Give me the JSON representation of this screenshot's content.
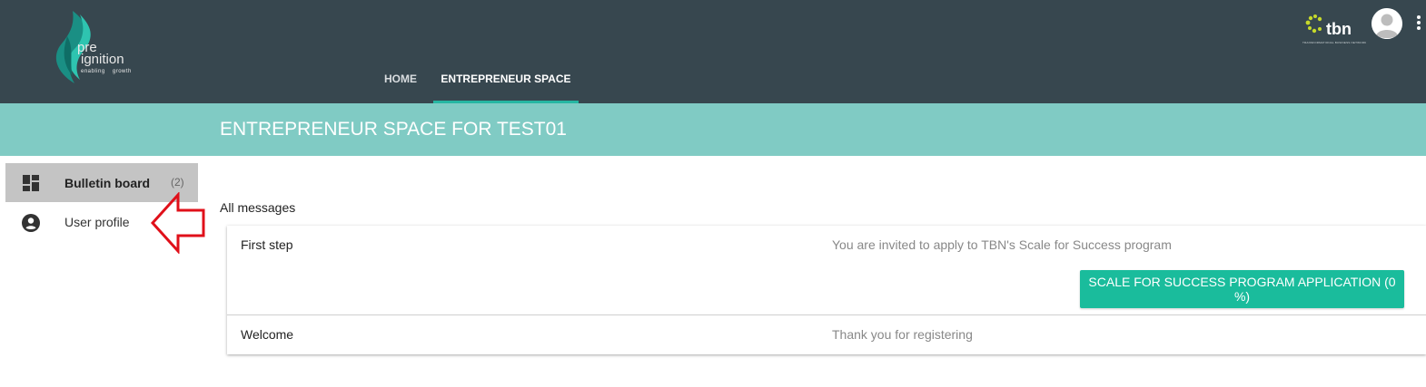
{
  "logo": {
    "line1": "pre",
    "line2": "ignition",
    "tagline": "enabling growth"
  },
  "nav": {
    "tabs": [
      {
        "label": "HOME"
      },
      {
        "label": "ENTREPRENEUR SPACE"
      }
    ]
  },
  "partner": {
    "name": "tbn",
    "subtitle": "TRANSFORMATIONAL BUSINESS NETWORK"
  },
  "header": {
    "avatar_icon": "account-circle-icon",
    "menu_icon": "more-vert-icon"
  },
  "banner": {
    "title": "ENTREPRENEUR SPACE FOR TEST01"
  },
  "sidebar": {
    "items": [
      {
        "label": "Bulletin board",
        "count": "(2)",
        "icon": "dashboard-icon"
      },
      {
        "label": "User profile",
        "icon": "account-circle-icon"
      }
    ]
  },
  "main": {
    "section_title": "All messages",
    "messages": [
      {
        "title": "First step",
        "body": "You are invited to apply to TBN's Scale for Success program",
        "action": "SCALE FOR SUCCESS PROGRAM APPLICATION (0 %)"
      },
      {
        "title": "Welcome",
        "body": "Thank you for registering"
      }
    ]
  },
  "colors": {
    "topbar": "#37474f",
    "banner": "#80cbc4",
    "accent": "#1abc9c",
    "arrow": "#e0101a"
  }
}
